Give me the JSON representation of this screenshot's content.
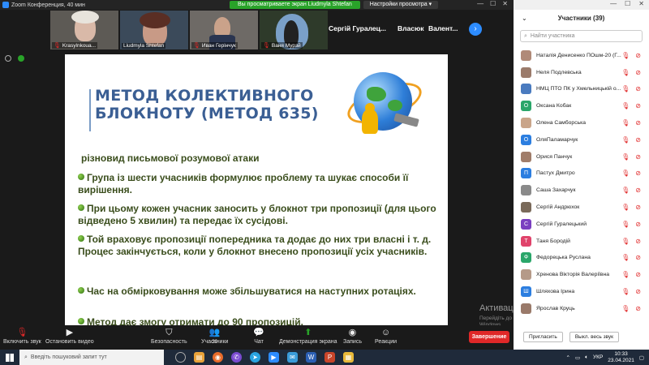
{
  "window": {
    "title": "Zoom Конференция, 40 мин",
    "viewing_banner": "Вы просматриваете экран Liudmyla Shtefan",
    "view_settings": "Настройки просмотра ▾"
  },
  "thumbnails": [
    {
      "name": "Krasylnkoua...",
      "muted": true
    },
    {
      "name": "Liudmyla Shtefan",
      "muted": false
    },
    {
      "name": "Иван Герінчук",
      "muted": true
    },
    {
      "name": "Ваня Мурзй",
      "muted": true
    }
  ],
  "name_tiles": [
    "Сергій Гуралец...",
    "Власюк",
    "Валент..."
  ],
  "slide": {
    "title_line1": "МЕТОД КОЛЕКТИВНОГО",
    "title_line2": "БЛОКНОТУ (МЕТОД 635)",
    "subtitle": "різновид письмової розумової атаки",
    "bullets": [
      "Група із шести учасників формулює проблему та шукає способи її вирішення.",
      "При цьому кожен учасник заносить у блокнот три пропозиції (для цього  відведено 5 хвилин) та передає їх сусідові.",
      "Той враховує пропозиції попередника та додає до них три власні і т. д. Процес закінчується, коли у блокнот внесено пропозиції усіх учасників.",
      "Час на обмірковування може збільшуватися на наступних ротаціях.",
      "Метод дає змогу отримати до 90 пропозицій."
    ]
  },
  "toolbar": {
    "unmute": "Включить звук",
    "stop_video": "Остановить видео",
    "security": "Безопасность",
    "participants": "Участники",
    "participants_count": "39",
    "chat": "Чат",
    "share_screen": "Демонстрация экрана",
    "record": "Запись",
    "reactions": "Реакции",
    "end": "Завершение"
  },
  "panel": {
    "header": "Участники (39)",
    "search_placeholder": "Найти участника",
    "participants": [
      {
        "name": "Наталія Денисенко ПОшм-20 (Г...",
        "initial": "",
        "color": "#b08a78"
      },
      {
        "name": "Неля Подлевська",
        "initial": "",
        "color": "#9b7b6b"
      },
      {
        "name": "НМЦ ПТО ПК у Хмельницькій о...",
        "initial": "",
        "color": "#4a7bbf"
      },
      {
        "name": "Оксана Кобак",
        "initial": "О",
        "color": "#2aa66a"
      },
      {
        "name": "Олена Самборська",
        "initial": "",
        "color": "#c9a58a"
      },
      {
        "name": "ОляПаламарчук",
        "initial": "О",
        "color": "#2c7ee0"
      },
      {
        "name": "Орися Панчук",
        "initial": "",
        "color": "#a07d6a"
      },
      {
        "name": "Пастух Дмитро",
        "initial": "П",
        "color": "#2c7ee0"
      },
      {
        "name": "Саша Захарчук",
        "initial": "",
        "color": "#8a8a8a"
      },
      {
        "name": "Сергій Андрюхок",
        "initial": "",
        "color": "#7a6a5a"
      },
      {
        "name": "Сергій Гуралецький",
        "initial": "С",
        "color": "#7a3fc0"
      },
      {
        "name": "Таня Бородій",
        "initial": "Т",
        "color": "#e0436b"
      },
      {
        "name": "Федорецька Руслана",
        "initial": "Ф",
        "color": "#2aa66a"
      },
      {
        "name": "Хренова Вікторія Валеріївна",
        "initial": "",
        "color": "#b59a88"
      },
      {
        "name": "Шляхова Ірина",
        "initial": "Ш",
        "color": "#2c7ee0"
      },
      {
        "name": "Ярослав Круць",
        "initial": "",
        "color": "#9a7a6a"
      }
    ],
    "invite": "Пригласить",
    "mute_all": "Выкл. весь звук"
  },
  "activation": {
    "title": "Активація Windows",
    "subtitle": "Перейдіть до розділу «Настройки», щоб активувати Windows."
  },
  "taskbar": {
    "search_placeholder": "Введіть пошуковий запит тут",
    "lang": "УКР",
    "time": "10:33",
    "date": "23.04.2021"
  }
}
